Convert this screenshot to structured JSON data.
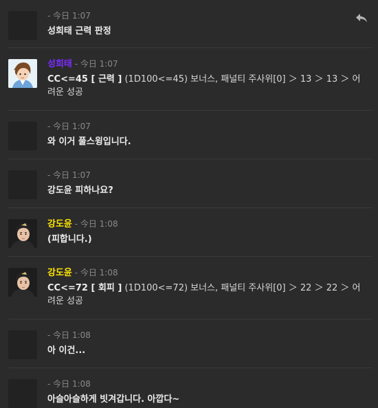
{
  "messages": [
    {
      "author": "",
      "time": "- 今日 1:07",
      "text": "성희태 근력 판정",
      "avatar": "empty"
    },
    {
      "author": "성희태",
      "author_color": "#7b2cff",
      "time": " - 今日 1:07",
      "prefix": "CC<=45  [ 근력 ]",
      "roll": " (1D100<=45) 보너스, 패널티 주사위[0] ＞ 13 ＞ 13 ＞ 어려운 성공",
      "avatar": "brown-hair-character-avatar"
    },
    {
      "author": "",
      "time": "- 今日 1:07",
      "text": "와 이거 풀스윙입니다.",
      "avatar": "empty"
    },
    {
      "author": "",
      "time": "- 今日 1:07",
      "text": "강도윤 피하나요?",
      "avatar": "empty"
    },
    {
      "author": "강도윤",
      "author_color": "#ffe600",
      "time": " - 今日 1:08",
      "text": "(피합니다.)",
      "avatar": "dark-hair-character-avatar"
    },
    {
      "author": "강도윤",
      "author_color": "#ffe600",
      "time": " - 今日 1:08",
      "prefix": "CC<=72  [ 회피 ]",
      "roll": " (1D100<=72) 보너스, 패널티 주사위[0] ＞ 22 ＞ 22 ＞ 어려운 성공",
      "avatar": "dark-hair-character-avatar"
    },
    {
      "author": "",
      "time": "- 今日 1:08",
      "text": "아 이건...",
      "avatar": "empty"
    },
    {
      "author": "",
      "time": "- 今日 1:08",
      "text": "아슬아슬하게 빗겨갑니다. 아깝다~",
      "avatar": "empty"
    }
  ],
  "icons": {
    "reply": "reply-arrow-icon"
  }
}
